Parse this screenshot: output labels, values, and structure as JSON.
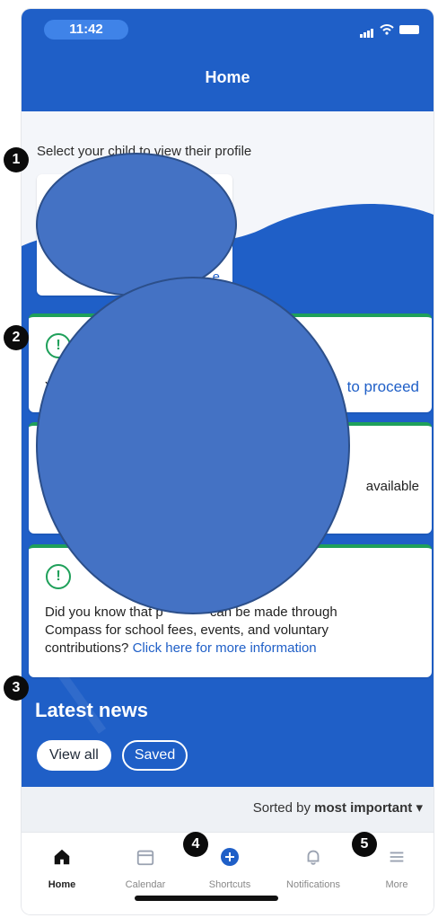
{
  "status_bar": {
    "time": "11:42"
  },
  "header": {
    "title": "Home"
  },
  "child_select": {
    "label": "Select your child to view their profile",
    "link_text": "e"
  },
  "cards": {
    "card1": {
      "text": "Y",
      "link": "to proceed"
    },
    "card2": {
      "text": "available"
    },
    "card3": {
      "text_lines": [
        "Did you know that p",
        "can be made through",
        "Compass for school fees, events, and voluntary",
        "contributions?"
      ],
      "link": "Click here for more information"
    }
  },
  "latest_news": {
    "title": "Latest news",
    "tabs": [
      "View all",
      "Saved"
    ]
  },
  "sort": {
    "prefix": "Sorted by",
    "value": "most important",
    "caret": "▾"
  },
  "tab_bar": {
    "items": [
      {
        "label": "Home",
        "icon": "home-icon",
        "active": true
      },
      {
        "label": "Calendar",
        "icon": "calendar-icon",
        "active": false
      },
      {
        "label": "Shortcuts",
        "icon": "plus-circle-icon",
        "active": false
      },
      {
        "label": "Notifications",
        "icon": "bell-icon",
        "active": false
      },
      {
        "label": "More",
        "icon": "menu-icon",
        "active": false
      }
    ]
  },
  "markers": [
    "1",
    "2",
    "3",
    "4",
    "5"
  ],
  "colors": {
    "brand": "#1f5fc7",
    "alert_green": "#1fa05a",
    "redaction": "#4472c4"
  }
}
